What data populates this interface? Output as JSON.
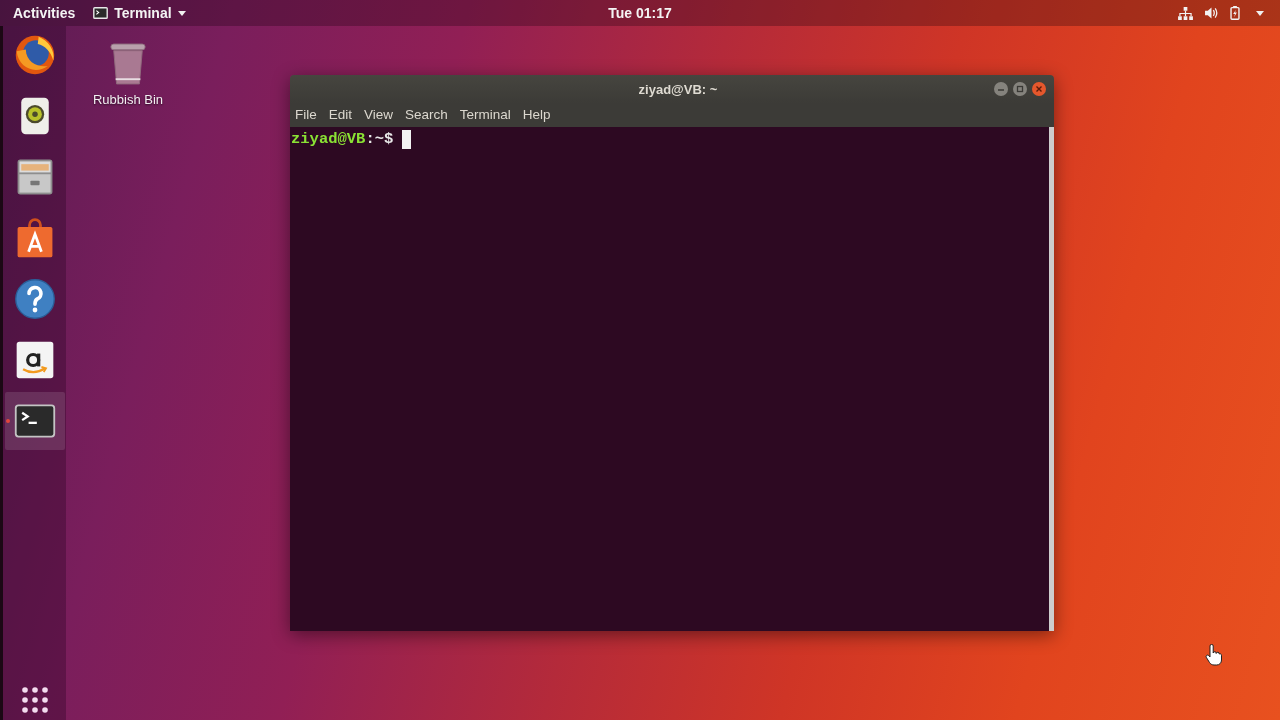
{
  "top_bar": {
    "activities": "Activities",
    "app_menu": {
      "label": "Terminal"
    },
    "clock": "Tue 01:17"
  },
  "dock": {
    "items": [
      {
        "kind": "browser",
        "selected": false,
        "running": false
      },
      {
        "kind": "music",
        "selected": false,
        "running": false
      },
      {
        "kind": "files",
        "selected": false,
        "running": false
      },
      {
        "kind": "software",
        "selected": false,
        "running": false
      },
      {
        "kind": "help",
        "selected": false,
        "running": false
      },
      {
        "kind": "shop",
        "selected": false,
        "running": false
      },
      {
        "kind": "terminal",
        "selected": true,
        "running": true
      }
    ]
  },
  "desktop_icons": [
    {
      "label": "Rubbish Bin"
    }
  ],
  "terminal_window": {
    "title": "ziyad@VB: ~",
    "menu": [
      "File",
      "Edit",
      "View",
      "Search",
      "Terminal",
      "Help"
    ],
    "prompt": {
      "user_host": "ziyad@VB",
      "path": ":~$"
    }
  }
}
